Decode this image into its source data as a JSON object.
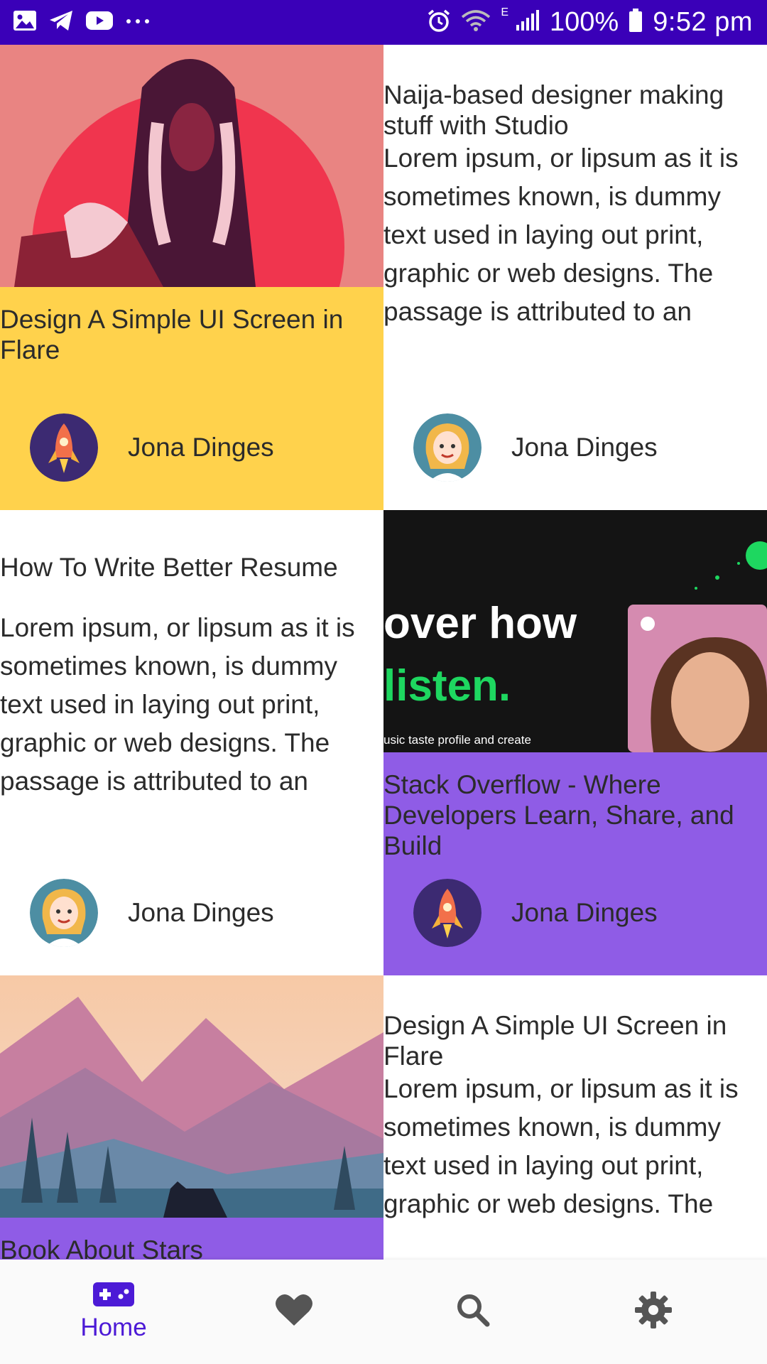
{
  "status_bar": {
    "time": "9:52 pm",
    "battery": "100%",
    "network_letter": "E",
    "left_icons": [
      "gallery-icon",
      "telegram-icon",
      "youtube-icon",
      "more-dots-icon"
    ],
    "right_icons": [
      "alarm-icon",
      "wifi-icon",
      "signal-icon",
      "battery-icon"
    ]
  },
  "cards": [
    {
      "title": "Design A Simple UI Screen in Flare",
      "author": "Jona Dinges",
      "avatar": "rocket-avatar",
      "color": "#ffd24c",
      "image": "woman-illustration"
    },
    {
      "title": "Naija-based designer making stuff with Studio",
      "body": "Lorem ipsum, or lipsum as it is sometimes known, is dummy text used in laying out print, graphic or web designs. The passage is attributed to an",
      "author": "Jona Dinges",
      "avatar": "girl-avatar"
    },
    {
      "title": "How To Write Better Resume",
      "body": "Lorem ipsum, or lipsum as it is sometimes known, is dummy text used in laying out print, graphic or web designs. The passage is attributed to an",
      "author": "Jona Dinges",
      "avatar": "girl-avatar"
    },
    {
      "title": "Stack Overflow - Where Developers Learn, Share, and Build",
      "author": "Jona Dinges",
      "avatar": "rocket-avatar",
      "color": "#8f5ce6",
      "image": "spotify-promo",
      "image_text": {
        "line1": "over how",
        "line2": "listen.",
        "line3": "usic taste profile and create"
      }
    },
    {
      "title": "Book About Stars",
      "color": "#8f5ce6",
      "image": "mountain-landscape"
    },
    {
      "title": "Design A Simple UI Screen in Flare",
      "body": "Lorem ipsum, or lipsum as it is sometimes known, is dummy text used in laying out print, graphic or web designs. The"
    }
  ],
  "bottom_nav": {
    "items": [
      {
        "label": "Home",
        "icon": "gamepad-icon",
        "active": true
      },
      {
        "label": "",
        "icon": "heart-icon",
        "active": false
      },
      {
        "label": "",
        "icon": "search-icon",
        "active": false
      },
      {
        "label": "",
        "icon": "gear-icon",
        "active": false
      }
    ],
    "active_color": "#4c1ad6",
    "inactive_color": "#555555"
  },
  "colors": {
    "status_bar": "#3a00b8",
    "yellow_card": "#ffd24c",
    "purple_card": "#8f5ce6"
  }
}
